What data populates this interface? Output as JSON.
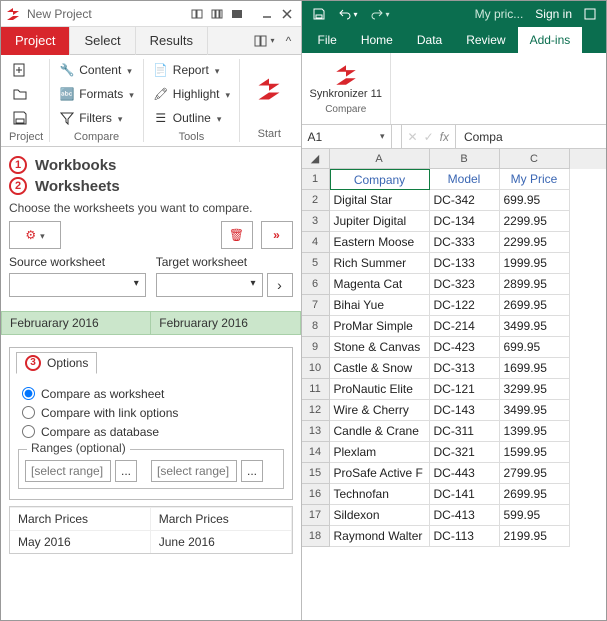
{
  "left": {
    "title": "New Project",
    "tabs": {
      "project": "Project",
      "select": "Select",
      "results": "Results"
    },
    "ribbon": {
      "content": "Content",
      "formats": "Formats",
      "filters": "Filters",
      "report": "Report",
      "highlight": "Highlight",
      "outline": "Outline",
      "start": "Start",
      "group1": "Project",
      "group2": "Compare",
      "group3": "Tools"
    },
    "sec1": "Workbooks",
    "sec2": "Worksheets",
    "instr": "Choose the worksheets you want to compare.",
    "srcLabel": "Source worksheet",
    "tgtLabel": "Target worksheet",
    "month": {
      "a": "Februarary 2016",
      "b": "Februarary 2016"
    },
    "options": {
      "tab": "Options",
      "r1": "Compare as worksheet",
      "r2": "Compare with link options",
      "r3": "Compare as database",
      "rangesTitle": "Ranges (optional)",
      "rangePlaceholder": "[select range]",
      "rangeBtn": "..."
    },
    "footer": {
      "h1": "March Prices",
      "h2": "March Prices",
      "v1": "May 2016",
      "v2": "June 2016"
    }
  },
  "excel": {
    "titleDoc": "My pric...",
    "signin": "Sign in",
    "tabs": [
      "File",
      "Home",
      "Data",
      "Review",
      "Add-ins"
    ],
    "activeTab": 4,
    "ribbon": {
      "syncName": "Synkronizer 11",
      "groupLabel": "Compare"
    },
    "namebox": "A1",
    "fxValue": "Compa",
    "cols": [
      "A",
      "B",
      "C"
    ],
    "headers": [
      "Company",
      "Model",
      "My Price"
    ],
    "rows": [
      [
        "Digital Star",
        "DC-342",
        "699.95"
      ],
      [
        "Jupiter Digital",
        "DC-134",
        "2299.95"
      ],
      [
        "Eastern Moose",
        "DC-333",
        "2299.95"
      ],
      [
        "Rich Summer",
        "DC-133",
        "1999.95"
      ],
      [
        "Magenta Cat",
        "DC-323",
        "2899.95"
      ],
      [
        "Bihai Yue",
        "DC-122",
        "2699.95"
      ],
      [
        "ProMar Simple",
        "DC-214",
        "3499.95"
      ],
      [
        "Stone & Canvas",
        "DC-423",
        "699.95"
      ],
      [
        "Castle & Snow",
        "DC-313",
        "1699.95"
      ],
      [
        "ProNautic Elite",
        "DC-121",
        "3299.95"
      ],
      [
        "Wire & Cherry",
        "DC-143",
        "3499.95"
      ],
      [
        "Candle & Crane",
        "DC-311",
        "1399.95"
      ],
      [
        "Plexlam",
        "DC-321",
        "1599.95"
      ],
      [
        "ProSafe Active F",
        "DC-443",
        "2799.95"
      ],
      [
        "Technofan",
        "DC-141",
        "2699.95"
      ],
      [
        "Sildexon",
        "DC-413",
        "599.95"
      ],
      [
        "Raymond Walter",
        "DC-113",
        "2199.95"
      ]
    ]
  }
}
